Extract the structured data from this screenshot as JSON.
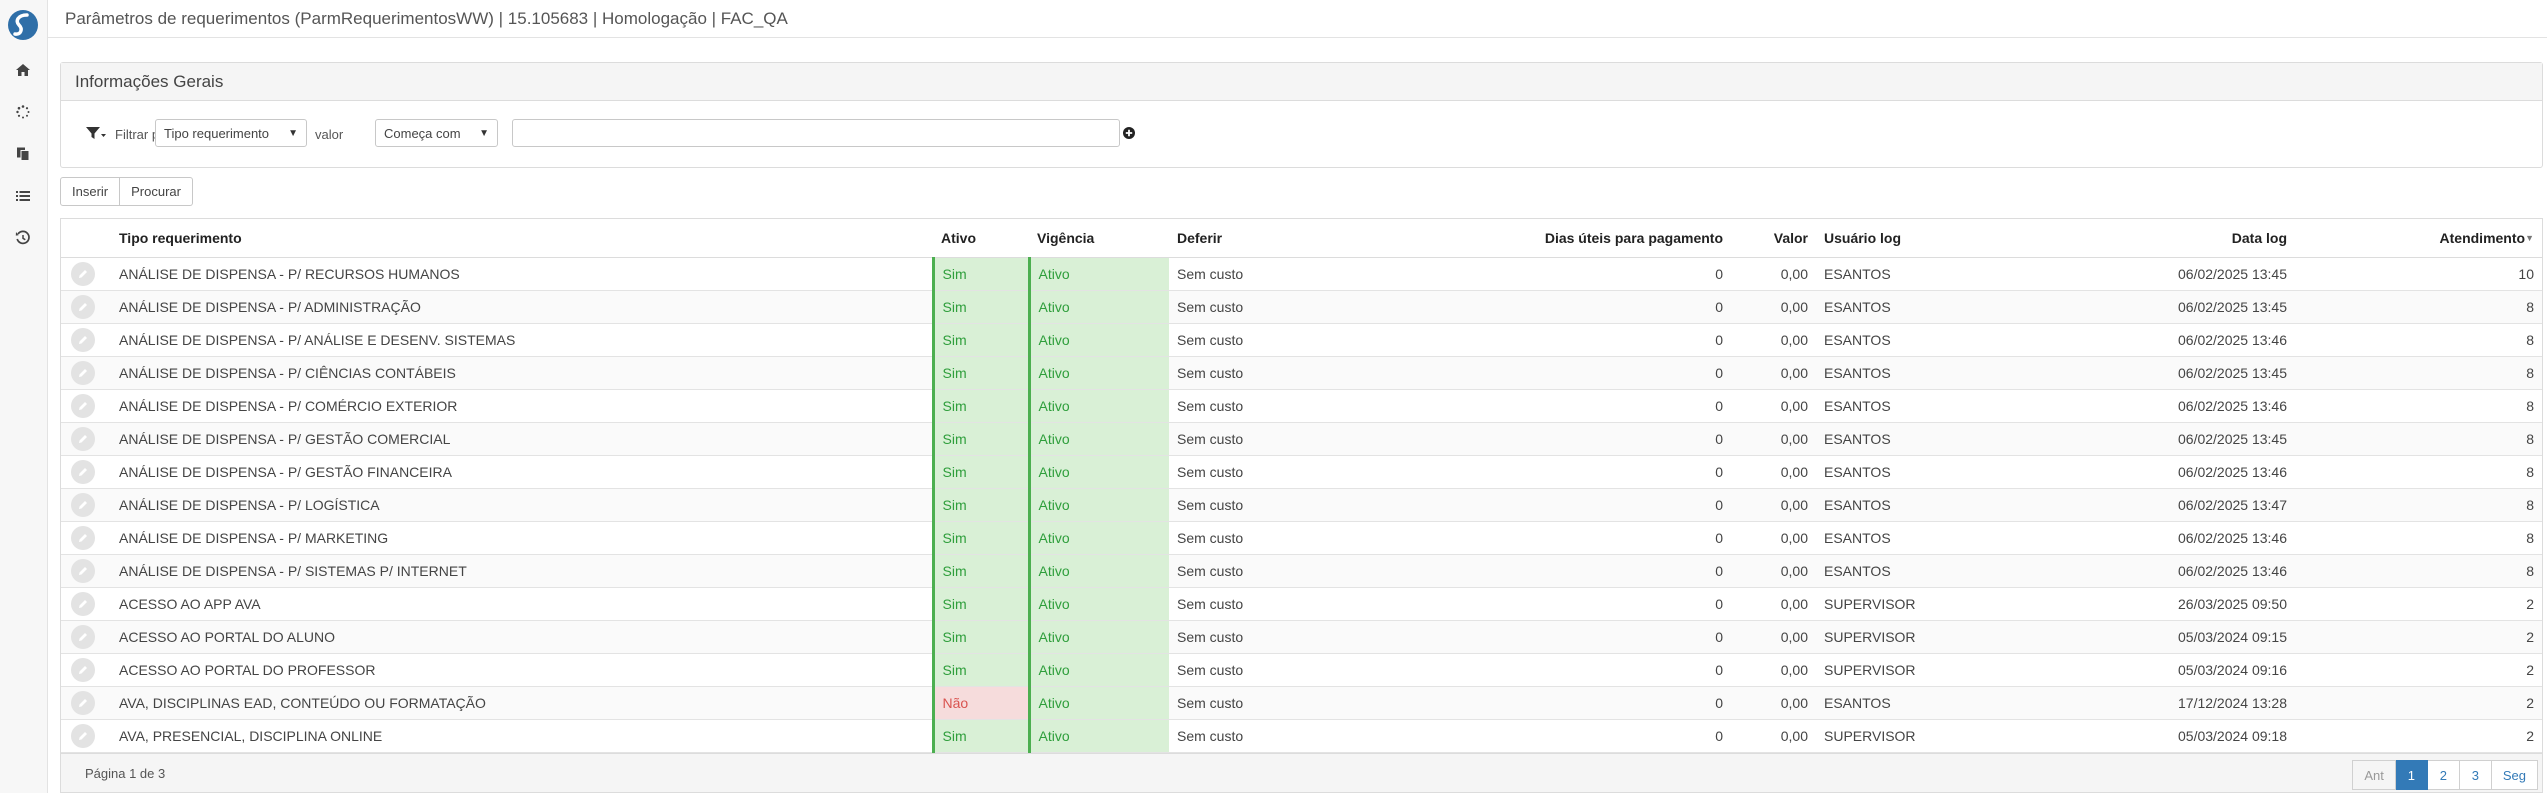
{
  "header": {
    "title": "Parâmetros de requerimentos (ParmRequerimentosWW) | 15.105683 | Homologação | FAC_QA"
  },
  "sidebar": {
    "icons": [
      "home-icon",
      "loading-icon",
      "documents-icon",
      "list-icon",
      "history-icon"
    ]
  },
  "panel": {
    "title": "Informações Gerais",
    "filter_label": "Filtrar por",
    "filter_field": "Tipo requerimento",
    "value_label": "valor",
    "operator": "Começa com",
    "value": ""
  },
  "actions": {
    "insert_label": "Inserir",
    "search_label": "Procurar"
  },
  "table": {
    "columns": [
      "Tipo requerimento",
      "Ativo",
      "Vigência",
      "Deferir",
      "Dias úteis para pagamento",
      "Valor",
      "Usuário log",
      "Data log",
      "Atendimento"
    ],
    "rows": [
      {
        "tipo": "ANÁLISE DE DISPENSA - P/ RECURSOS HUMANOS",
        "ativo": "Sim",
        "vigencia": "Ativo",
        "deferir": "Sem custo",
        "dias": "0",
        "valor": "0,00",
        "usuario": "ESANTOS",
        "data": "06/02/2025 13:45",
        "atendimento": "10"
      },
      {
        "tipo": "ANÁLISE DE DISPENSA - P/ ADMINISTRAÇÃO",
        "ativo": "Sim",
        "vigencia": "Ativo",
        "deferir": "Sem custo",
        "dias": "0",
        "valor": "0,00",
        "usuario": "ESANTOS",
        "data": "06/02/2025 13:45",
        "atendimento": "8"
      },
      {
        "tipo": "ANÁLISE DE DISPENSA - P/ ANÁLISE E DESENV. SISTEMAS",
        "ativo": "Sim",
        "vigencia": "Ativo",
        "deferir": "Sem custo",
        "dias": "0",
        "valor": "0,00",
        "usuario": "ESANTOS",
        "data": "06/02/2025 13:46",
        "atendimento": "8"
      },
      {
        "tipo": "ANÁLISE DE DISPENSA - P/ CIÊNCIAS CONTÁBEIS",
        "ativo": "Sim",
        "vigencia": "Ativo",
        "deferir": "Sem custo",
        "dias": "0",
        "valor": "0,00",
        "usuario": "ESANTOS",
        "data": "06/02/2025 13:45",
        "atendimento": "8"
      },
      {
        "tipo": "ANÁLISE DE DISPENSA - P/ COMÉRCIO EXTERIOR",
        "ativo": "Sim",
        "vigencia": "Ativo",
        "deferir": "Sem custo",
        "dias": "0",
        "valor": "0,00",
        "usuario": "ESANTOS",
        "data": "06/02/2025 13:46",
        "atendimento": "8"
      },
      {
        "tipo": "ANÁLISE DE DISPENSA - P/ GESTÃO COMERCIAL",
        "ativo": "Sim",
        "vigencia": "Ativo",
        "deferir": "Sem custo",
        "dias": "0",
        "valor": "0,00",
        "usuario": "ESANTOS",
        "data": "06/02/2025 13:45",
        "atendimento": "8"
      },
      {
        "tipo": "ANÁLISE DE DISPENSA - P/ GESTÃO FINANCEIRA",
        "ativo": "Sim",
        "vigencia": "Ativo",
        "deferir": "Sem custo",
        "dias": "0",
        "valor": "0,00",
        "usuario": "ESANTOS",
        "data": "06/02/2025 13:46",
        "atendimento": "8"
      },
      {
        "tipo": "ANÁLISE DE DISPENSA - P/ LOGÍSTICA",
        "ativo": "Sim",
        "vigencia": "Ativo",
        "deferir": "Sem custo",
        "dias": "0",
        "valor": "0,00",
        "usuario": "ESANTOS",
        "data": "06/02/2025 13:47",
        "atendimento": "8"
      },
      {
        "tipo": "ANÁLISE DE DISPENSA - P/ MARKETING",
        "ativo": "Sim",
        "vigencia": "Ativo",
        "deferir": "Sem custo",
        "dias": "0",
        "valor": "0,00",
        "usuario": "ESANTOS",
        "data": "06/02/2025 13:46",
        "atendimento": "8"
      },
      {
        "tipo": "ANÁLISE DE DISPENSA - P/ SISTEMAS P/ INTERNET",
        "ativo": "Sim",
        "vigencia": "Ativo",
        "deferir": "Sem custo",
        "dias": "0",
        "valor": "0,00",
        "usuario": "ESANTOS",
        "data": "06/02/2025 13:46",
        "atendimento": "8"
      },
      {
        "tipo": "ACESSO AO APP AVA",
        "ativo": "Sim",
        "vigencia": "Ativo",
        "deferir": "Sem custo",
        "dias": "0",
        "valor": "0,00",
        "usuario": "SUPERVISOR",
        "data": "26/03/2025 09:50",
        "atendimento": "2"
      },
      {
        "tipo": "ACESSO AO PORTAL DO ALUNO",
        "ativo": "Sim",
        "vigencia": "Ativo",
        "deferir": "Sem custo",
        "dias": "0",
        "valor": "0,00",
        "usuario": "SUPERVISOR",
        "data": "05/03/2024 09:15",
        "atendimento": "2"
      },
      {
        "tipo": "ACESSO AO PORTAL DO PROFESSOR",
        "ativo": "Sim",
        "vigencia": "Ativo",
        "deferir": "Sem custo",
        "dias": "0",
        "valor": "0,00",
        "usuario": "SUPERVISOR",
        "data": "05/03/2024 09:16",
        "atendimento": "2"
      },
      {
        "tipo": "AVA, DISCIPLINAS EAD, CONTEÚDO OU FORMATAÇÃO",
        "ativo": "Não",
        "vigencia": "Ativo",
        "deferir": "Sem custo",
        "dias": "0",
        "valor": "0,00",
        "usuario": "ESANTOS",
        "data": "17/12/2024 13:28",
        "atendimento": "2"
      },
      {
        "tipo": "AVA, PRESENCIAL, DISCIPLINA ONLINE",
        "ativo": "Sim",
        "vigencia": "Ativo",
        "deferir": "Sem custo",
        "dias": "0",
        "valor": "0,00",
        "usuario": "SUPERVISOR",
        "data": "05/03/2024 09:18",
        "atendimento": "2"
      }
    ]
  },
  "footer": {
    "page_info": "Página 1 de 3",
    "prev_label": "Ant",
    "pages": [
      "1",
      "2",
      "3"
    ],
    "next_label": "Seg"
  },
  "colors": {
    "accent": "#337ab7",
    "active_bg": "#d9f0d6",
    "active_text": "#2e9e3b",
    "inactive_bg": "#f6dcdc",
    "inactive_text": "#d9534f"
  }
}
